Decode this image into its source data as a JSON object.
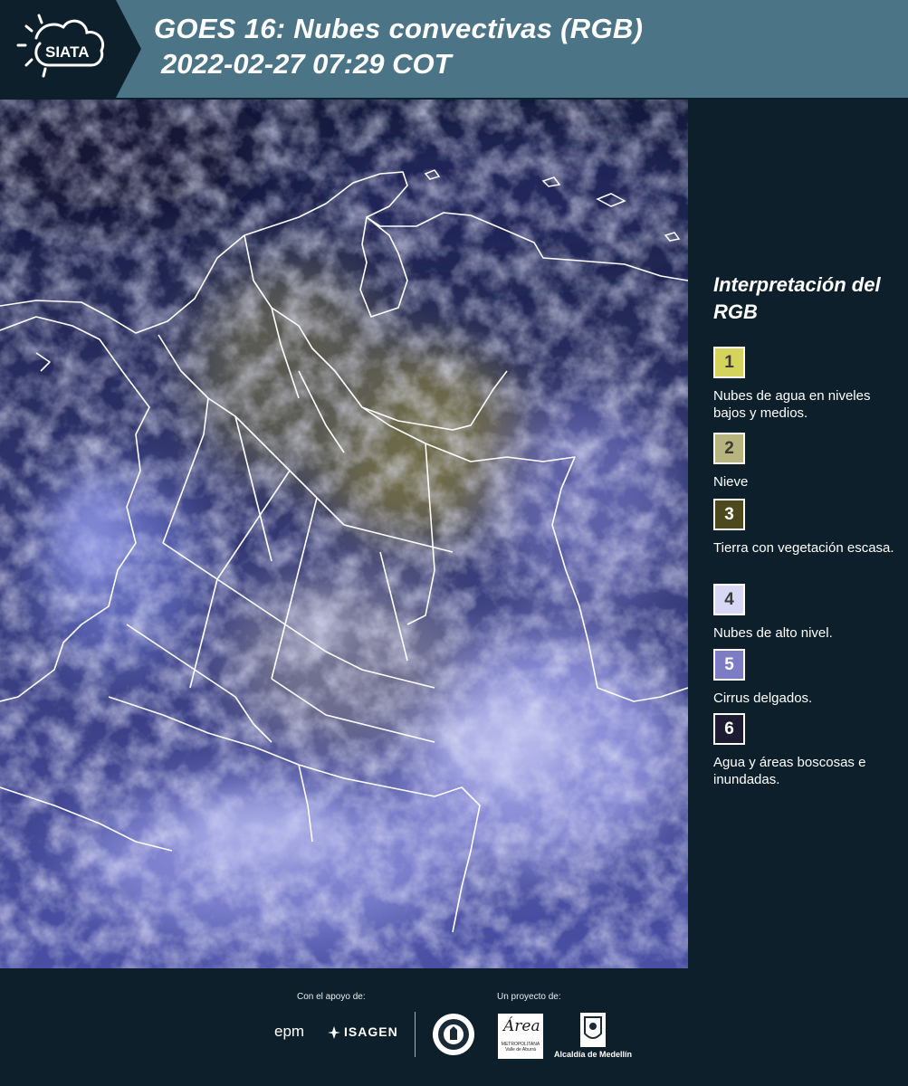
{
  "header": {
    "logo_text": "SIATA",
    "title_line1": "GOES 16: Nubes convectivas (RGB)",
    "title_line2": "2022-02-27 07:29 COT",
    "background_color": "#4b7487"
  },
  "map": {
    "colors": {
      "ocean": "#141a3c",
      "cloud_high": "#c9ccf2",
      "cloud_cirrus": "#6f74c8",
      "cloud_low": "#8f8a58",
      "borders": "#ffffff"
    }
  },
  "legend": {
    "title": "Interpretación del RGB",
    "items": [
      {
        "number": "1",
        "label": "Nubes de agua en niveles bajos y medios.",
        "color": "#d4d45c"
      },
      {
        "number": "2",
        "label": "Nieve",
        "color": "#b8b480"
      },
      {
        "number": "3",
        "label": "Tierra con vegetación escasa.",
        "color": "#4c4a1c"
      },
      {
        "number": "4",
        "label": "Nubes de alto nivel.",
        "color": "#d8d8f4"
      },
      {
        "number": "5",
        "label": "Cirrus delgados.",
        "color": "#7b7cc4"
      },
      {
        "number": "6",
        "label": "Agua y áreas boscosas e inundadas.",
        "color": "#1c1b2f"
      }
    ]
  },
  "footer": {
    "support_label": "Con el apoyo de:",
    "project_label": "Un proyecto de:",
    "epm_text": "epm",
    "isagen_text": "ISAGEN",
    "area_text": "Área",
    "area_subtext": "METROPOLITANA Valle de Aburrá",
    "alcaldia_text": "Alcaldía de Medellín"
  }
}
